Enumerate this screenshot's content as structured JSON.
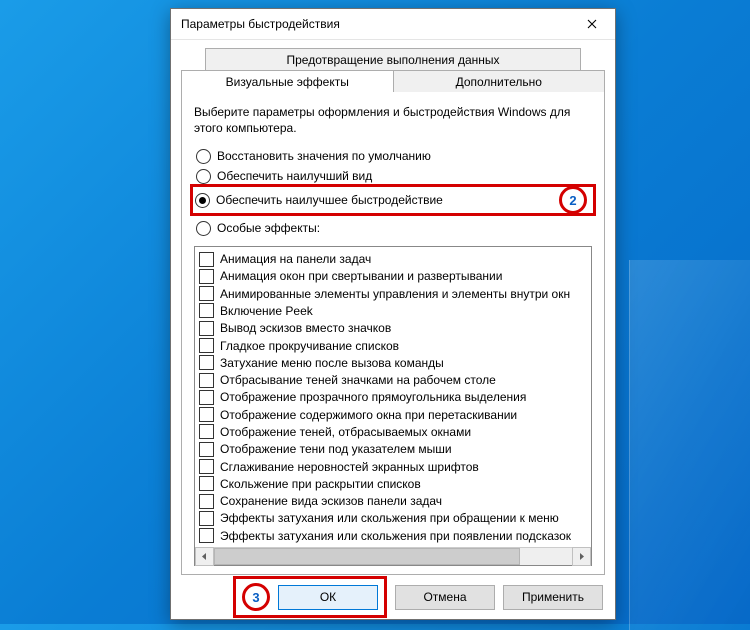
{
  "window": {
    "title": "Параметры быстродействия"
  },
  "tabs": {
    "row1": "Предотвращение выполнения данных",
    "row2a": "Визуальные эффекты",
    "row2b": "Дополнительно"
  },
  "intro": "Выберите параметры оформления и быстродействия Windows для этого компьютера.",
  "radios": {
    "restore": "Восстановить значения по умолчанию",
    "best_look": "Обеспечить наилучший вид",
    "best_perf": "Обеспечить наилучшее быстродействие",
    "custom": "Особые эффекты:"
  },
  "effects": [
    "Анимация на панели задач",
    "Анимация окон при свертывании и развертывании",
    "Анимированные элементы управления и элементы внутри окн",
    "Включение Peek",
    "Вывод эскизов вместо значков",
    "Гладкое прокручивание списков",
    "Затухание меню после вызова команды",
    "Отбрасывание теней значками на рабочем столе",
    "Отображение прозрачного прямоугольника выделения",
    "Отображение содержимого окна при перетаскивании",
    "Отображение теней, отбрасываемых окнами",
    "Отображение тени под указателем мыши",
    "Сглаживание неровностей экранных шрифтов",
    "Скольжение при раскрытии списков",
    "Сохранение вида эскизов панели задач",
    "Эффекты затухания или скольжения при обращении к меню",
    "Эффекты затухания или скольжения при появлении подсказок"
  ],
  "buttons": {
    "ok": "ОК",
    "cancel": "Отмена",
    "apply": "Применить"
  },
  "annotations": {
    "step2": "2",
    "step3": "3"
  }
}
